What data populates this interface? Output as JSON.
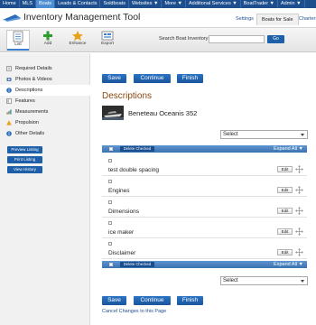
{
  "topnav": {
    "items": [
      "Home",
      "MLS",
      "Boats",
      "Leads & Contacts",
      "Soldboats",
      "Websites ▼",
      "More ▼",
      "Additional Services ▼",
      "BoatTrader ▼",
      "Admin ▼"
    ],
    "active_index": 2,
    "bg_color": "#1d4f8f",
    "active_color": "#4d8fd1"
  },
  "header": {
    "title": "Inventory Management Tool",
    "tabs": [
      "Settings",
      "Boats for Sale",
      "Charters"
    ]
  },
  "toolbar": {
    "tools": [
      {
        "label": "List",
        "icon": "list-icon"
      },
      {
        "label": "Add",
        "icon": "add-icon"
      },
      {
        "label": "Enhance",
        "icon": "enhance-icon"
      },
      {
        "label": "Export",
        "icon": "export-icon"
      }
    ],
    "search_label": "Search Boat Inventory:",
    "search_value": "",
    "go_label": "Go"
  },
  "sidebar": {
    "items": [
      {
        "label": "Required Details",
        "icon": "details-icon"
      },
      {
        "label": "Photos & Videos",
        "icon": "photos-icon"
      },
      {
        "label": "Descriptions",
        "icon": "info-icon"
      },
      {
        "label": "Features",
        "icon": "features-icon"
      },
      {
        "label": "Measurements",
        "icon": "measurements-icon"
      },
      {
        "label": "Propulsion",
        "icon": "propulsion-icon"
      },
      {
        "label": "Other Details",
        "icon": "info-icon"
      }
    ],
    "active_index": 2,
    "buttons": [
      "Preview Listing",
      "Print Listing",
      "View History"
    ]
  },
  "actions": {
    "save": "Save",
    "continue": "Continue",
    "finish": "Finish",
    "cancel_link": "Cancel Changes to this Page"
  },
  "main": {
    "section_title": "Descriptions",
    "boat_name": "Beneteau Oceanis 352",
    "select_value": "Select",
    "delete_checked": "Delete Checked",
    "expand_all": "Expand All ▼",
    "rows": [
      {
        "label": "test double spacing",
        "edit": "Edit"
      },
      {
        "label": "Engines",
        "edit": "Edit"
      },
      {
        "label": "Dimensions",
        "edit": "Edit"
      },
      {
        "label": "ice maker",
        "edit": "Edit"
      },
      {
        "label": "Disclaimer",
        "edit": "Edit"
      }
    ]
  }
}
